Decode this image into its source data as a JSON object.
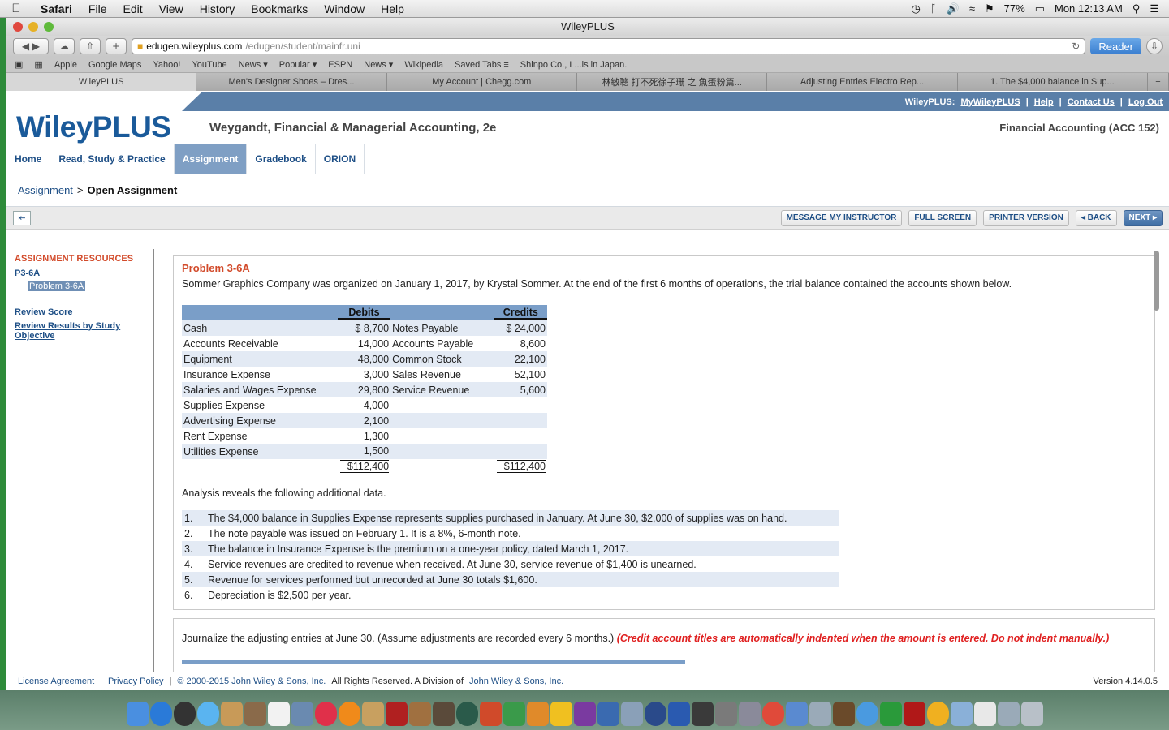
{
  "menubar": {
    "app": "Safari",
    "items": [
      "File",
      "Edit",
      "View",
      "History",
      "Bookmarks",
      "Window",
      "Help"
    ],
    "battery": "77%",
    "clock": "Mon 12:13 AM"
  },
  "window": {
    "title": "WileyPLUS"
  },
  "toolbar": {
    "url_host": "edugen.wileyplus.com",
    "url_path": "/edugen/student/mainfr.uni",
    "reader": "Reader"
  },
  "bookmarks": [
    "Apple",
    "Google Maps",
    "Yahoo!",
    "YouTube",
    "News ▾",
    "Popular ▾",
    "ESPN",
    "News ▾",
    "Wikipedia",
    "Saved Tabs ≡",
    "Shinpo Co., L...ls in Japan."
  ],
  "tabs": [
    "WileyPLUS",
    "Men's Designer Shoes – Dres...",
    "My Account | Chegg.com",
    "林敏聰 打不死徐子珊 之 魚蛋粉篇...",
    "Adjusting Entries Electro Rep...",
    "1. The $4,000 balance in Sup..."
  ],
  "topstrip": {
    "label": "WileyPLUS:",
    "links": [
      "MyWileyPLUS",
      "Help",
      "Contact Us",
      "Log Out"
    ]
  },
  "header": {
    "logo": "WileyPLUS",
    "course": "Weygandt, Financial & Managerial Accounting, 2e",
    "section": "Financial Accounting (ACC 152)"
  },
  "nav": [
    "Home",
    "Read, Study & Practice",
    "Assignment",
    "Gradebook",
    "ORION"
  ],
  "breadcrumb": {
    "link": "Assignment",
    "sep": ">",
    "current": "Open Assignment"
  },
  "actions": [
    "MESSAGE MY INSTRUCTOR",
    "FULL SCREEN",
    "PRINTER VERSION",
    "◂ BACK",
    "NEXT ▸"
  ],
  "sidebar": {
    "heading": "ASSIGNMENT RESOURCES",
    "item": "P3-6A",
    "subitem": "Problem 3-6A",
    "review_score": "Review Score",
    "review_results": "Review Results by Study Objective"
  },
  "problem": {
    "title": "Problem 3-6A",
    "intro": "Sommer Graphics Company was organized on January 1, 2017, by Krystal Sommer. At the end of the first 6 months of operations, the trial balance contained the accounts shown below.",
    "debits_header": "Debits",
    "credits_header": "Credits",
    "rows": [
      {
        "da": "Cash",
        "dv": "$ 8,700",
        "ca": "Notes Payable",
        "cv": "$ 24,000"
      },
      {
        "da": "Accounts Receivable",
        "dv": "14,000",
        "ca": "Accounts Payable",
        "cv": "8,600"
      },
      {
        "da": "Equipment",
        "dv": "48,000",
        "ca": "Common Stock",
        "cv": "22,100"
      },
      {
        "da": "Insurance Expense",
        "dv": "3,000",
        "ca": "Sales Revenue",
        "cv": "52,100"
      },
      {
        "da": "Salaries and Wages Expense",
        "dv": "29,800",
        "ca": "Service Revenue",
        "cv": "5,600"
      },
      {
        "da": "Supplies Expense",
        "dv": "4,000",
        "ca": "",
        "cv": ""
      },
      {
        "da": "Advertising Expense",
        "dv": "2,100",
        "ca": "",
        "cv": ""
      },
      {
        "da": "Rent Expense",
        "dv": "1,300",
        "ca": "",
        "cv": ""
      },
      {
        "da": "Utilities Expense",
        "dv": "1,500",
        "ca": "",
        "cv": ""
      }
    ],
    "total_debits": "$112,400",
    "total_credits": "$112,400",
    "analysis": "Analysis reveals the following additional data.",
    "items": [
      {
        "n": "1.",
        "t": "The $4,000 balance in Supplies Expense represents supplies purchased in January. At June 30, $2,000 of supplies was on hand."
      },
      {
        "n": "2.",
        "t": "The note payable was issued on February 1. It is a 8%, 6-month note."
      },
      {
        "n": "3.",
        "t": "The balance in Insurance Expense is the premium on a one-year policy, dated March 1, 2017."
      },
      {
        "n": "4.",
        "t": "Service revenues are credited to revenue when received. At June 30, service revenue of $1,400 is unearned."
      },
      {
        "n": "5.",
        "t": "Revenue for services performed but unrecorded at June 30 totals $1,600."
      },
      {
        "n": "6.",
        "t": "Depreciation is $2,500 per year."
      }
    ],
    "instruction": "Journalize the adjusting entries at June 30. (Assume adjustments are recorded every 6 months.)",
    "instruction_note": "(Credit account titles are automatically indented when the amount is entered. Do not indent manually.)"
  },
  "footer": {
    "links": [
      "License Agreement",
      "Privacy Policy",
      "© 2000-2015 John Wiley & Sons, Inc."
    ],
    "rights": "All Rights Reserved. A Division of",
    "company": "John Wiley & Sons, Inc.",
    "version": "Version 4.14.0.5"
  }
}
